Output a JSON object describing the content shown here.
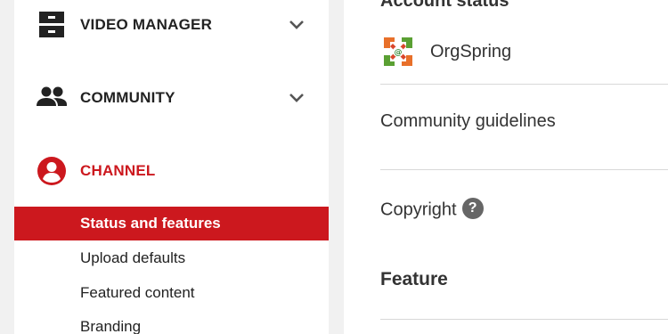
{
  "sidebar": {
    "sections": {
      "video_manager": {
        "label": "VIDEO MANAGER",
        "icon": "video-manager-icon"
      },
      "community": {
        "label": "COMMUNITY",
        "icon": "people-icon"
      },
      "channel": {
        "label": "CHANNEL",
        "icon": "account-circle-icon"
      }
    },
    "channel_items": [
      {
        "label": "Status and features",
        "active": true
      },
      {
        "label": "Upload defaults",
        "active": false
      },
      {
        "label": "Featured content",
        "active": false
      },
      {
        "label": "Branding",
        "active": false
      }
    ]
  },
  "main": {
    "account_heading": "Account status",
    "account_name": "OrgSpring",
    "community_guidelines": "Community guidelines",
    "copyright": "Copyright",
    "copyright_help": "?",
    "feature_heading": "Feature"
  },
  "colors": {
    "accent": "#cc181e",
    "text": "#222222",
    "background": "#f1f1f1",
    "panel": "#ffffff"
  }
}
